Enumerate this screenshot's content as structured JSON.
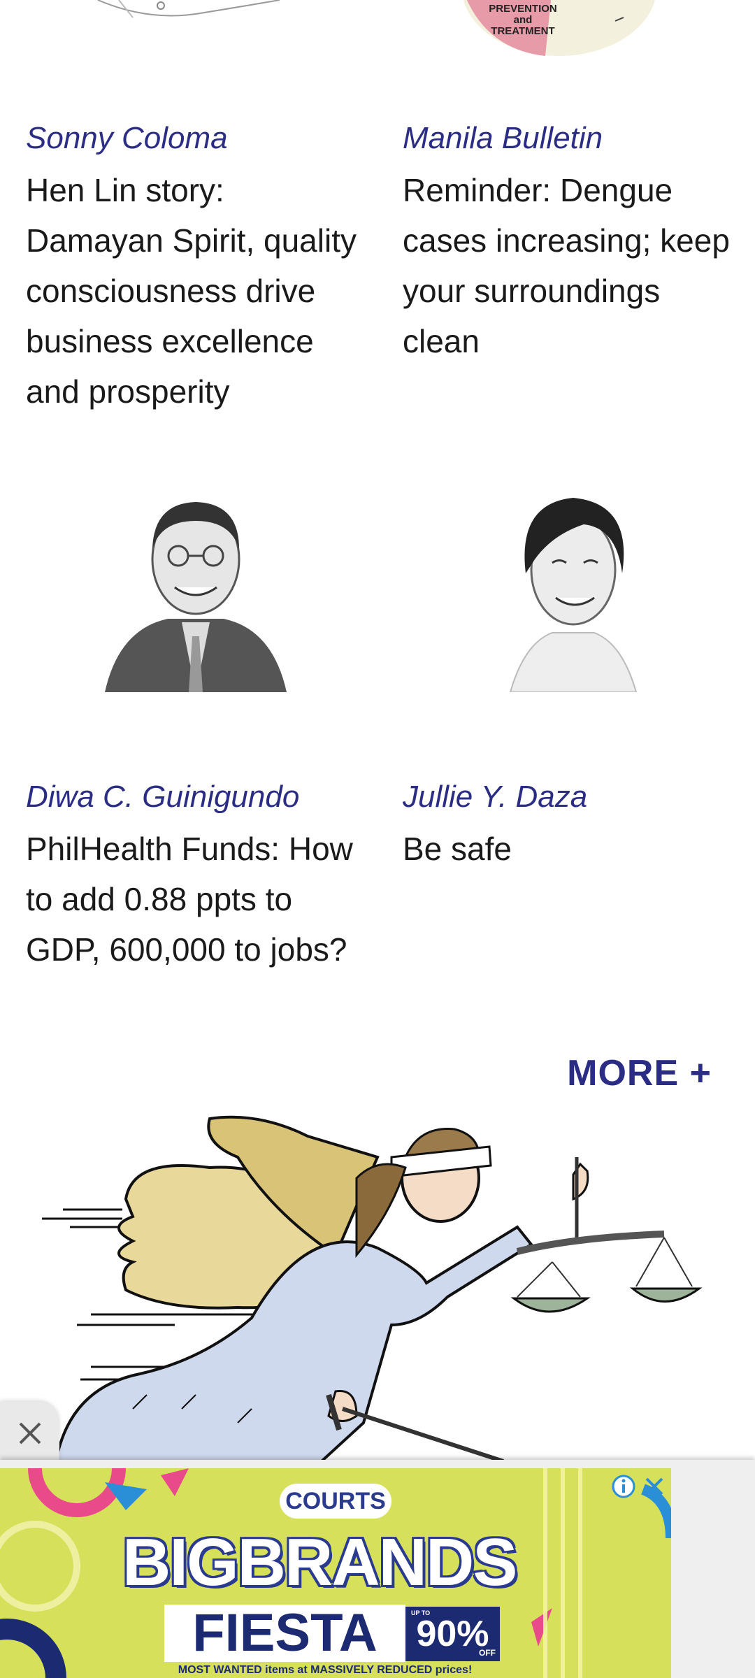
{
  "top_thumb_text": [
    "PREVENTION",
    "and",
    "TREATMENT"
  ],
  "articles": [
    {
      "author": "Sonny Coloma",
      "headline": "Hen Lin story: Damayan Spirit, quality consciousness drive business excellence and prosperity"
    },
    {
      "author": "Manila Bulletin",
      "headline": "Reminder: Dengue cases increasing; keep your surroundings clean"
    },
    {
      "author": "Diwa C. Guinigundo",
      "headline": "PhilHealth Funds: How to add 0.88 ppts to GDP, 600,000 to jobs?"
    },
    {
      "author": "Jullie Y. Daza",
      "headline": "Be safe"
    }
  ],
  "more_label": "MORE +",
  "ad": {
    "brand": "COURTS",
    "title": "BIGBRANDS",
    "subtitle": "FIESTA",
    "discount": "90%",
    "discount_prefix": "UP TO",
    "discount_suffix": "OFF",
    "fine_print": "MOST WANTED items at MASSIVELY REDUCED prices!",
    "background_color": "#d6e05b",
    "accent_color": "#1c2a72"
  },
  "colors": {
    "author": "#2b2d85",
    "more": "#2b2d85"
  }
}
